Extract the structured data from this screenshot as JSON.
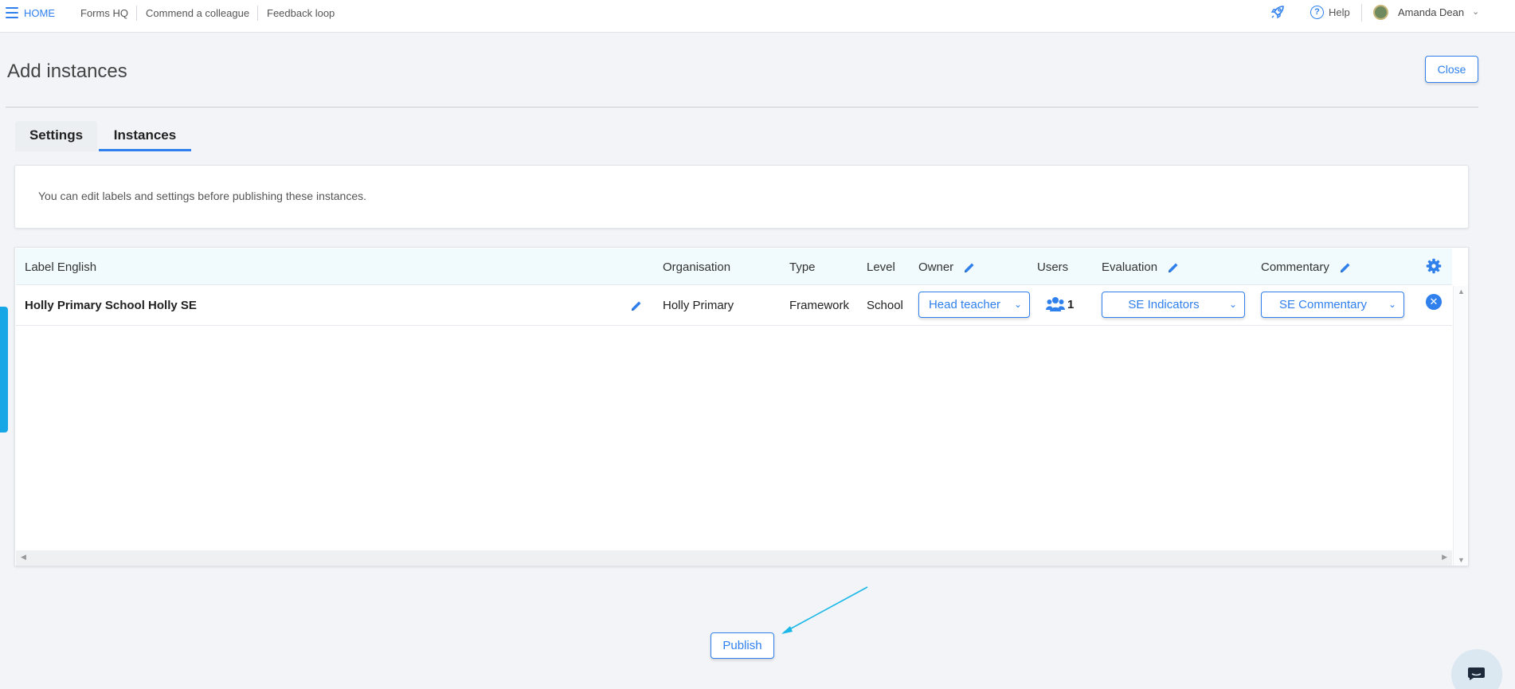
{
  "topbar": {
    "home": "HOME",
    "links": [
      "Forms HQ",
      "Commend a colleague",
      "Feedback loop"
    ],
    "help": "Help",
    "user_name": "Amanda Dean"
  },
  "page": {
    "title": "Add instances",
    "close_label": "Close"
  },
  "tabs": [
    {
      "label": "Settings",
      "active": false
    },
    {
      "label": "Instances",
      "active": true
    }
  ],
  "info_text": "You can edit labels and settings before publishing these instances.",
  "table": {
    "headers": {
      "label": "Label English",
      "organisation": "Organisation",
      "type": "Type",
      "level": "Level",
      "owner": "Owner",
      "users": "Users",
      "evaluation": "Evaluation",
      "commentary": "Commentary"
    },
    "rows": [
      {
        "label": "Holly Primary School Holly SE",
        "organisation": "Holly Primary",
        "type": "Framework",
        "level": "School",
        "owner": "Head teacher",
        "users": "1",
        "evaluation": "SE Indicators",
        "commentary": "SE Commentary"
      }
    ]
  },
  "publish_label": "Publish",
  "colors": {
    "accent": "#2f80ed",
    "side_tab": "#18a7e6",
    "arrow": "#1ab8e8"
  }
}
